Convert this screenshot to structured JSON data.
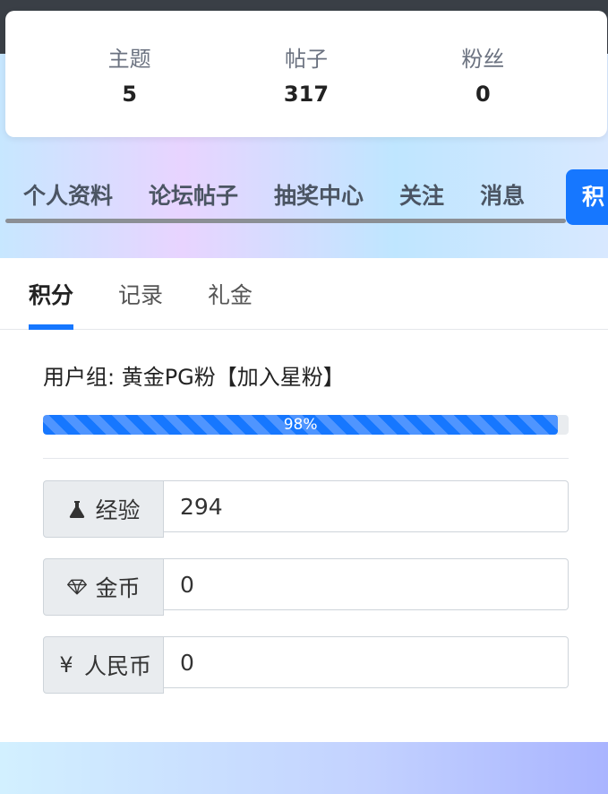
{
  "stats": [
    {
      "label": "主题",
      "value": "5"
    },
    {
      "label": "帖子",
      "value": "317"
    },
    {
      "label": "粉丝",
      "value": "0"
    }
  ],
  "nav": {
    "items": [
      "个人资料",
      "论坛帖子",
      "抽奖中心",
      "关注",
      "消息"
    ],
    "active": "积"
  },
  "tabs": {
    "items": [
      "积分",
      "记录",
      "礼金"
    ],
    "active_index": 0
  },
  "user_group": "用户组: 黄金PG粉【加入星粉】",
  "progress": {
    "label": "98%",
    "value": 98
  },
  "fields": [
    {
      "icon": "flask-icon",
      "label": "经验",
      "value": "294"
    },
    {
      "icon": "diamond-icon",
      "label": "金币",
      "value": "0"
    },
    {
      "icon": "yen-icon",
      "label": "人民币",
      "value": "0"
    }
  ],
  "colors": {
    "accent": "#1677ff"
  }
}
